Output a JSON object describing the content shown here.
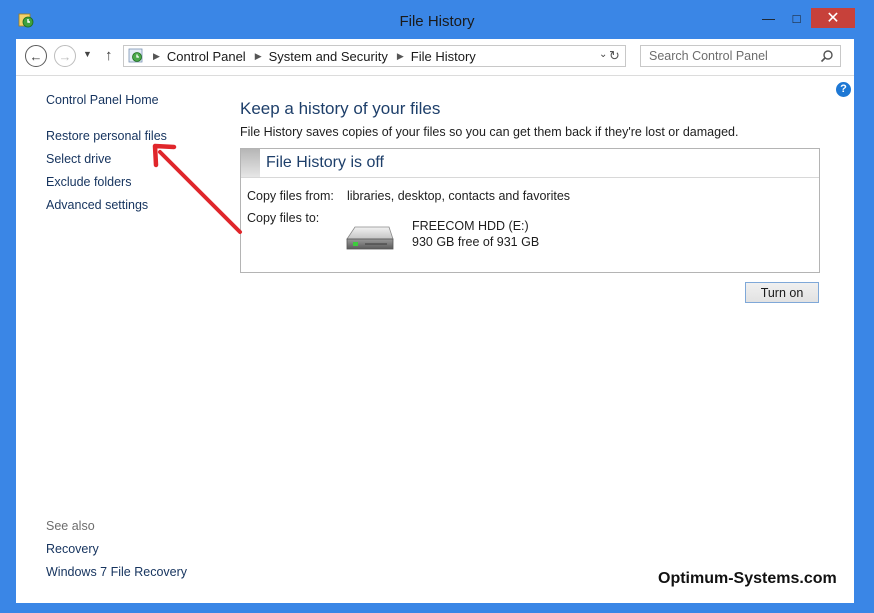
{
  "window": {
    "title": "File History"
  },
  "navigation": {
    "breadcrumbs": [
      "Control Panel",
      "System and Security",
      "File History"
    ],
    "search": {
      "placeholder": "Search Control Panel"
    }
  },
  "sidebar": {
    "home": "Control Panel Home",
    "links": [
      "Restore personal files",
      "Select drive",
      "Exclude folders",
      "Advanced settings"
    ],
    "see_also_title": "See also",
    "see_also": [
      "Recovery",
      "Windows 7 File Recovery"
    ]
  },
  "main": {
    "heading": "Keep a history of your files",
    "description": "File History saves copies of your files so you can get them back if they're lost or damaged.",
    "status": "File History is off",
    "copy_from_label": "Copy files from:",
    "copy_from_value": "libraries, desktop, contacts and favorites",
    "copy_to_label": "Copy files to:",
    "drive_name": "FREECOM HDD (E:)",
    "drive_free": "930 GB free of 931 GB",
    "turn_on_label": "Turn on"
  },
  "annotation": {
    "watermark": "Optimum-Systems.com",
    "arrow_color": "#e0262b"
  },
  "colors": {
    "window_frame": "#3a86e6",
    "link": "#15335e",
    "heading": "#1e3f6a",
    "close_button": "#c7413a"
  }
}
